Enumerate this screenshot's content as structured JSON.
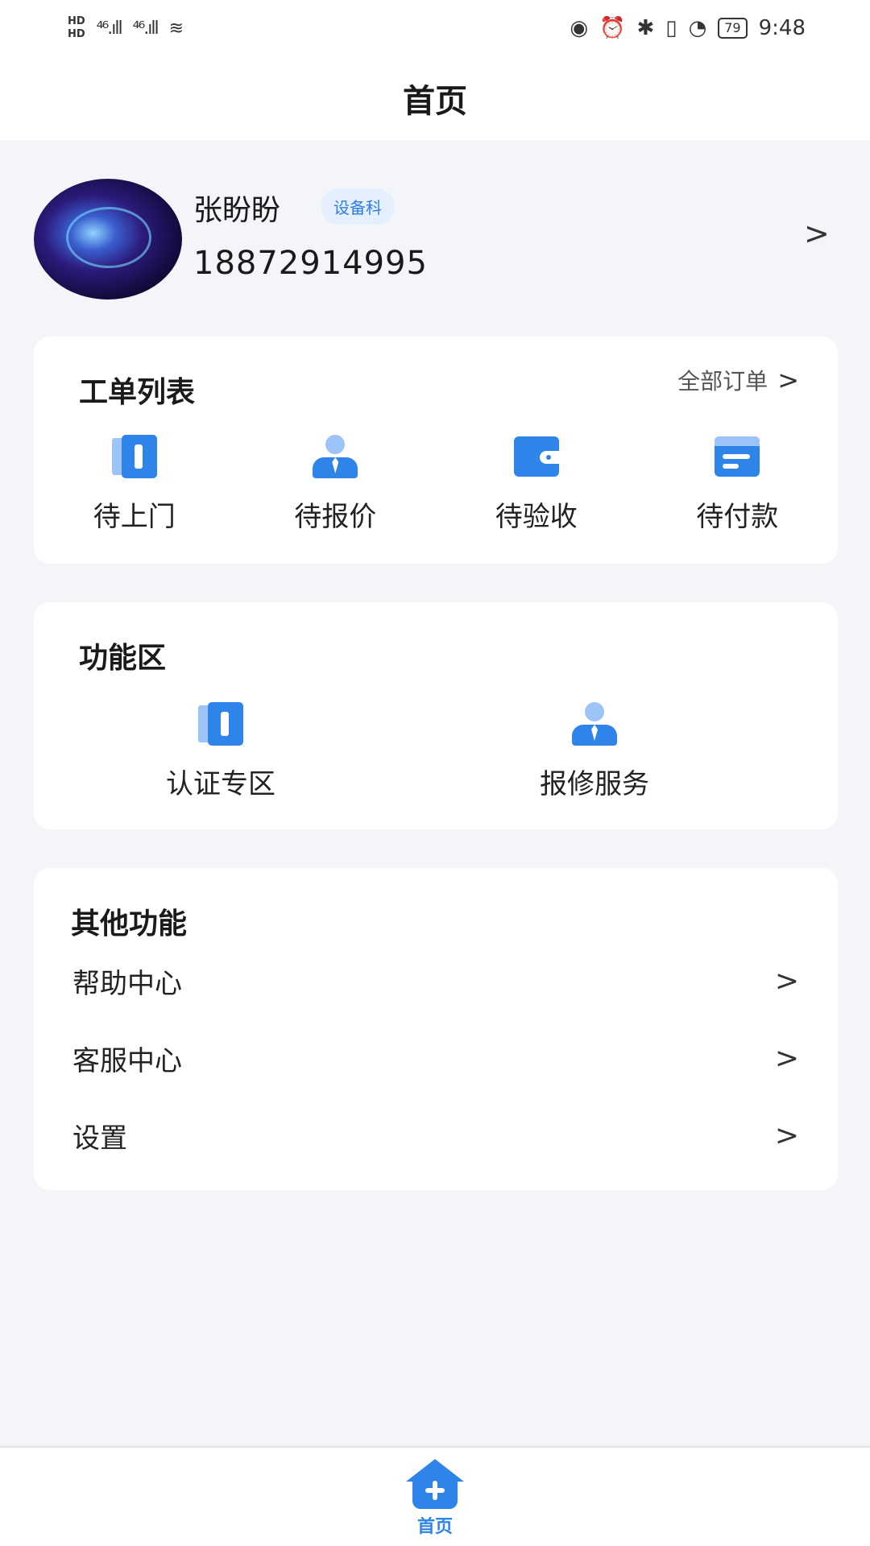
{
  "status_bar": {
    "hd1": "HD",
    "hd2": "HD",
    "signal1": "⁴⁶.ıll",
    "signal2": "⁴⁶.ıll",
    "wifi": "≋",
    "battery": "79",
    "time": "9:48"
  },
  "header": {
    "title": "首页"
  },
  "profile": {
    "name": "张盼盼",
    "department": "设备科",
    "phone": "18872914995"
  },
  "orders": {
    "title": "工单列表",
    "all_label": "全部订单",
    "items": [
      {
        "label": "待上门",
        "icon": "door-icon"
      },
      {
        "label": "待报价",
        "icon": "person-icon"
      },
      {
        "label": "待验收",
        "icon": "wallet-icon"
      },
      {
        "label": "待付款",
        "icon": "card-icon"
      }
    ]
  },
  "functions": {
    "title": "功能区",
    "items": [
      {
        "label": "认证专区",
        "icon": "door-icon"
      },
      {
        "label": "报修服务",
        "icon": "person-icon"
      }
    ]
  },
  "other": {
    "title": "其他功能",
    "items": [
      {
        "label": "帮助中心"
      },
      {
        "label": "客服中心"
      },
      {
        "label": "设置"
      }
    ]
  },
  "tabbar": {
    "home_label": "首页"
  },
  "colors": {
    "accent": "#2f84ea",
    "accent_light": "#9cc4f8",
    "background": "#f4f5f9"
  }
}
